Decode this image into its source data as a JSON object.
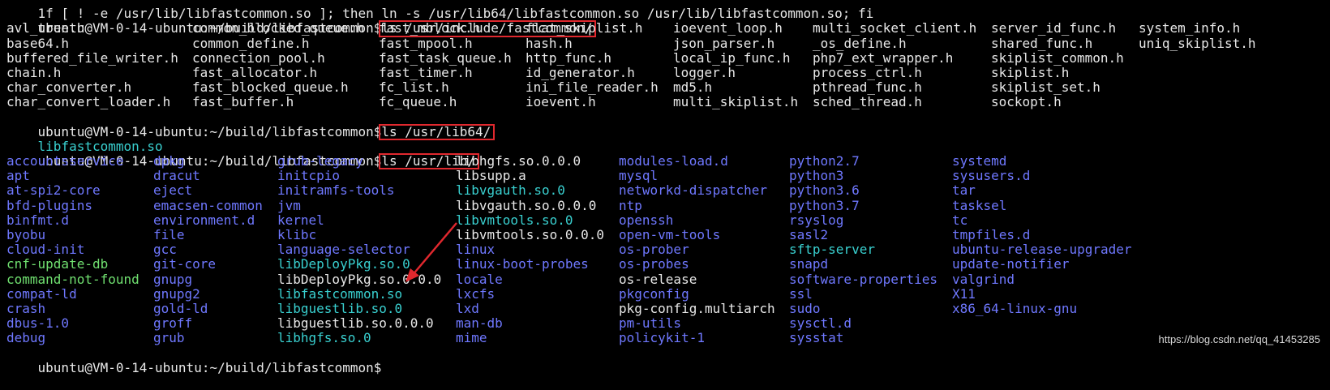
{
  "top_clipped_line": "1f [ ! -e /usr/lib/libfastcommon.so ]; then ln -s /usr/lib64/libfastcommon.so /usr/lib/libfastcommon.so; fi",
  "prompt": "ubuntu@VM-0-14-ubuntu:~/build/libfastcommon$",
  "commands": [
    "ls /usr/include/fastcommon/",
    "ls /usr/lib64/",
    "ls /usr/lib/"
  ],
  "include_listing": [
    [
      "avl_tree.h",
      "common_blocked_queue.h",
      "fast_mblock.h",
      "flat_skiplist.h",
      "ioevent_loop.h",
      "multi_socket_client.h",
      "server_id_func.h",
      "system_info.h"
    ],
    [
      "base64.h",
      "common_define.h",
      "fast_mpool.h",
      "hash.h",
      "json_parser.h",
      "_os_define.h",
      "shared_func.h",
      "uniq_skiplist.h"
    ],
    [
      "buffered_file_writer.h",
      "connection_pool.h",
      "fast_task_queue.h",
      "http_func.h",
      "local_ip_func.h",
      "php7_ext_wrapper.h",
      "skiplist_common.h",
      ""
    ],
    [
      "chain.h",
      "fast_allocator.h",
      "fast_timer.h",
      "id_generator.h",
      "logger.h",
      "process_ctrl.h",
      "skiplist.h",
      ""
    ],
    [
      "char_converter.h",
      "fast_blocked_queue.h",
      "fc_list.h",
      "ini_file_reader.h",
      "md5.h",
      "pthread_func.h",
      "skiplist_set.h",
      ""
    ],
    [
      "char_convert_loader.h",
      "fast_buffer.h",
      "fc_queue.h",
      "ioevent.h",
      "multi_skiplist.h",
      "sched_thread.h",
      "sockopt.h",
      ""
    ]
  ],
  "lib64_listing": "libfastcommon.so",
  "lib_listing": [
    [
      [
        "accountsservice",
        "dir"
      ],
      [
        "dpkg",
        "dir"
      ],
      [
        "grub-legacy",
        "dir"
      ],
      [
        "libhgfs.so.0.0.0",
        "file"
      ],
      [
        "modules-load.d",
        "dir"
      ],
      [
        "python2.7",
        "dir"
      ],
      [
        "systemd",
        "dir"
      ]
    ],
    [
      [
        "apt",
        "dir"
      ],
      [
        "dracut",
        "dir"
      ],
      [
        "initcpio",
        "dir"
      ],
      [
        "libsupp.a",
        "file"
      ],
      [
        "mysql",
        "dir"
      ],
      [
        "python3",
        "dir"
      ],
      [
        "sysusers.d",
        "dir"
      ]
    ],
    [
      [
        "at-spi2-core",
        "dir"
      ],
      [
        "eject",
        "dir"
      ],
      [
        "initramfs-tools",
        "dir"
      ],
      [
        "libvgauth.so.0",
        "link"
      ],
      [
        "networkd-dispatcher",
        "dir"
      ],
      [
        "python3.6",
        "dir"
      ],
      [
        "tar",
        "dir"
      ]
    ],
    [
      [
        "bfd-plugins",
        "dir"
      ],
      [
        "emacsen-common",
        "dir"
      ],
      [
        "jvm",
        "dir"
      ],
      [
        "libvgauth.so.0.0.0",
        "file"
      ],
      [
        "ntp",
        "dir"
      ],
      [
        "python3.7",
        "dir"
      ],
      [
        "tasksel",
        "dir"
      ]
    ],
    [
      [
        "binfmt.d",
        "dir"
      ],
      [
        "environment.d",
        "dir"
      ],
      [
        "kernel",
        "dir"
      ],
      [
        "libvmtools.so.0",
        "link"
      ],
      [
        "openssh",
        "dir"
      ],
      [
        "rsyslog",
        "dir"
      ],
      [
        "tc",
        "dir"
      ]
    ],
    [
      [
        "byobu",
        "dir"
      ],
      [
        "file",
        "dir"
      ],
      [
        "klibc",
        "dir"
      ],
      [
        "libvmtools.so.0.0.0",
        "file"
      ],
      [
        "open-vm-tools",
        "dir"
      ],
      [
        "sasl2",
        "dir"
      ],
      [
        "tmpfiles.d",
        "dir"
      ]
    ],
    [
      [
        "cloud-init",
        "dir"
      ],
      [
        "gcc",
        "dir"
      ],
      [
        "language-selector",
        "dir"
      ],
      [
        "linux",
        "dir"
      ],
      [
        "os-prober",
        "dir"
      ],
      [
        "sftp-server",
        "link"
      ],
      [
        "ubuntu-release-upgrader",
        "dir"
      ]
    ],
    [
      [
        "cnf-update-db",
        "exec"
      ],
      [
        "git-core",
        "dir"
      ],
      [
        "libDeployPkg.so.0",
        "link"
      ],
      [
        "linux-boot-probes",
        "dir"
      ],
      [
        "os-probes",
        "dir"
      ],
      [
        "snapd",
        "dir"
      ],
      [
        "update-notifier",
        "dir"
      ]
    ],
    [
      [
        "command-not-found",
        "exec"
      ],
      [
        "gnupg",
        "dir"
      ],
      [
        "libDeployPkg.so.0.0.0",
        "file"
      ],
      [
        "locale",
        "dir"
      ],
      [
        "os-release",
        "file"
      ],
      [
        "software-properties",
        "dir"
      ],
      [
        "valgrind",
        "dir"
      ]
    ],
    [
      [
        "compat-ld",
        "dir"
      ],
      [
        "gnupg2",
        "dir"
      ],
      [
        "libfastcommon.so",
        "link"
      ],
      [
        "lxcfs",
        "dir"
      ],
      [
        "pkgconfig",
        "dir"
      ],
      [
        "ssl",
        "dir"
      ],
      [
        "X11",
        "dir"
      ]
    ],
    [
      [
        "crash",
        "dir"
      ],
      [
        "gold-ld",
        "dir"
      ],
      [
        "libguestlib.so.0",
        "link"
      ],
      [
        "lxd",
        "dir"
      ],
      [
        "pkg-config.multiarch",
        "file"
      ],
      [
        "sudo",
        "dir"
      ],
      [
        "x86_64-linux-gnu",
        "dir"
      ]
    ],
    [
      [
        "dbus-1.0",
        "dir"
      ],
      [
        "groff",
        "dir"
      ],
      [
        "libguestlib.so.0.0.0",
        "file"
      ],
      [
        "man-db",
        "dir"
      ],
      [
        "pm-utils",
        "dir"
      ],
      [
        "sysctl.d",
        "dir"
      ],
      [
        "",
        ""
      ]
    ],
    [
      [
        "debug",
        "dir"
      ],
      [
        "grub",
        "dir"
      ],
      [
        "libhgfs.so.0",
        "link"
      ],
      [
        "mime",
        "dir"
      ],
      [
        "policykit-1",
        "dir"
      ],
      [
        "sysstat",
        "dir"
      ],
      [
        "",
        ""
      ]
    ]
  ],
  "bottom_clipped_line": "ubuntu@VM-0-14-ubuntu:~/build/libfastcommon$",
  "colors": {
    "background": "#000000",
    "text": "#e8e8e8",
    "dir": "#6f78ff",
    "exec": "#70e070",
    "link": "#39d0d0",
    "highlight": "#e0282e"
  },
  "watermark": "https://blog.csdn.net/qq_41453285"
}
